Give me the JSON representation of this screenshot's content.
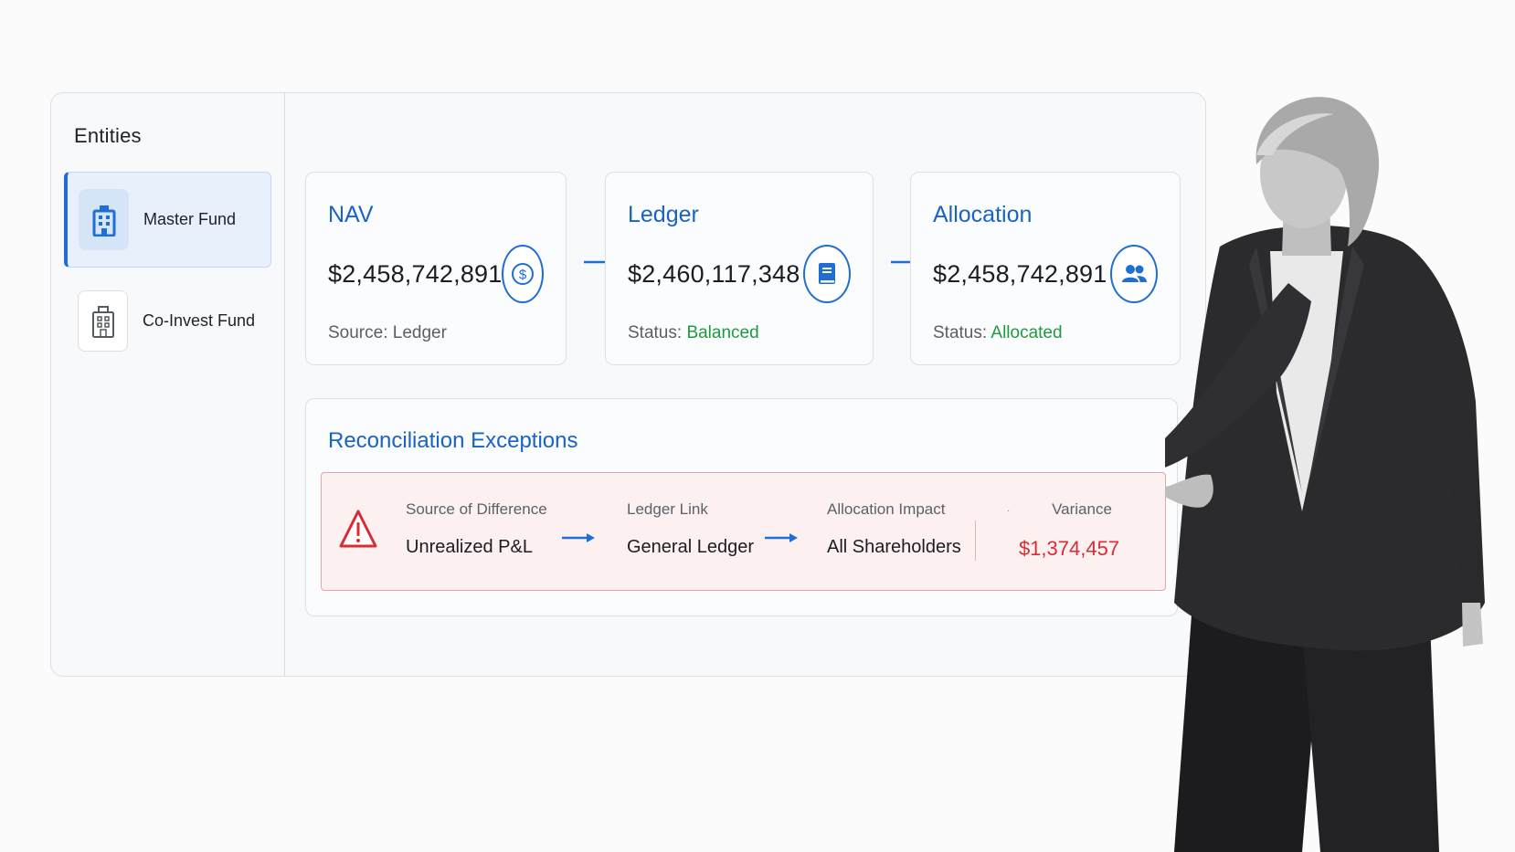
{
  "sidebar": {
    "title": "Entities",
    "items": [
      {
        "label": "Master Fund",
        "icon": "building-icon",
        "active": true
      },
      {
        "label": "Co-Invest Fund",
        "icon": "building-icon",
        "active": false
      }
    ]
  },
  "cards": [
    {
      "title": "NAV",
      "value": "$2,458,742,891",
      "meta_label": "Source:",
      "meta_value": "Ledger",
      "icon": "dollar-circle-icon"
    },
    {
      "title": "Ledger",
      "value": "$2,460,117,348",
      "meta_label": "Status:",
      "meta_value": "Balanced",
      "icon": "book-icon"
    },
    {
      "title": "Allocation",
      "value": "$2,458,742,891",
      "meta_label": "Status:",
      "meta_value": "Allocated",
      "icon": "users-icon"
    }
  ],
  "exceptions": {
    "title": "Reconciliation Exceptions",
    "source_label": "Source of Difference",
    "source_value": "Unrealized P&L",
    "ledger_label": "Ledger Link",
    "ledger_value": "General Ledger",
    "impact_label": "Allocation Impact",
    "impact_value": "All Shareholders",
    "variance_label": "Variance",
    "variance_value": "$1,374,457",
    "dot": "·"
  },
  "colors": {
    "accent": "#1f6ed4",
    "success": "#1e9a3f",
    "danger": "#d52e35"
  }
}
